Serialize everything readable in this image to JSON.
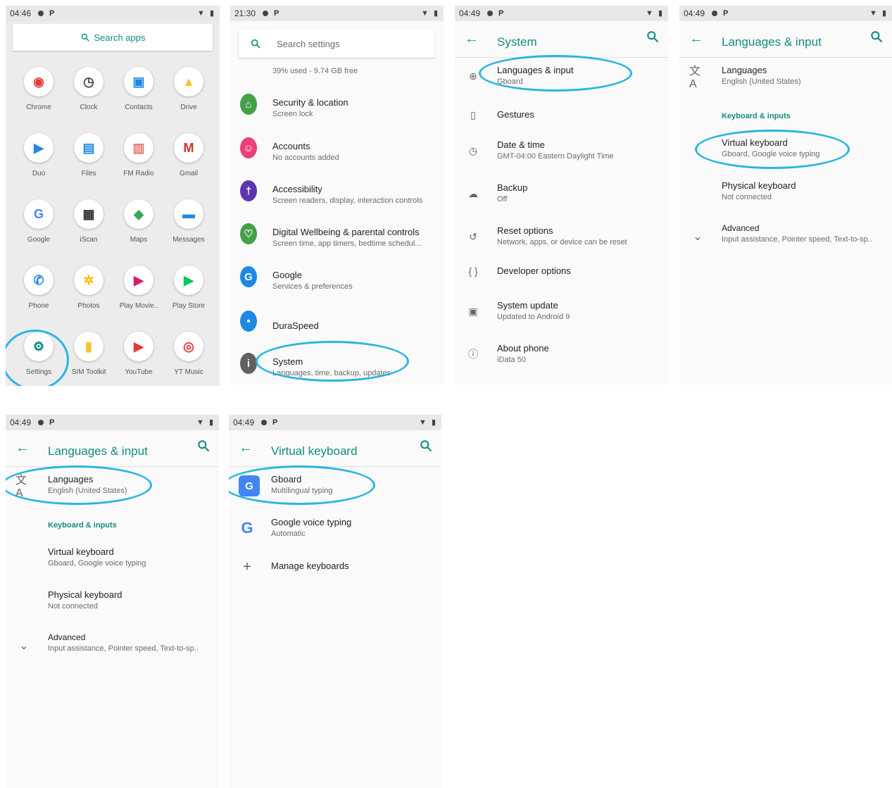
{
  "screen1": {
    "time": "04:46",
    "search_label": "Search apps",
    "apps": [
      {
        "label": "Chrome",
        "icon": "chrome-icon",
        "color": "#e53935"
      },
      {
        "label": "Clock",
        "icon": "clock-icon",
        "color": "#424242"
      },
      {
        "label": "Contacts",
        "icon": "contacts-icon",
        "color": "#1e88e5"
      },
      {
        "label": "Drive",
        "icon": "drive-icon",
        "color": "#fbc02d"
      },
      {
        "label": "Duo",
        "icon": "duo-icon",
        "color": "#1e88e5"
      },
      {
        "label": "Files",
        "icon": "files-icon",
        "color": "#1e88e5"
      },
      {
        "label": "FM Radio",
        "icon": "radio-icon",
        "color": "#e57373"
      },
      {
        "label": "Gmail",
        "icon": "gmail-icon",
        "color": "#d93025"
      },
      {
        "label": "Google",
        "icon": "google-icon",
        "color": "#4285f4"
      },
      {
        "label": "iScan",
        "icon": "barcode-icon",
        "color": "#333333"
      },
      {
        "label": "Maps",
        "icon": "maps-icon",
        "color": "#34a853"
      },
      {
        "label": "Messages",
        "icon": "messages-icon",
        "color": "#1e88e5"
      },
      {
        "label": "Phone",
        "icon": "phone-icon",
        "color": "#1e88e5"
      },
      {
        "label": "Photos",
        "icon": "photos-icon",
        "color": "#fbbc04"
      },
      {
        "label": "Play Movie..",
        "icon": "play-movies-icon",
        "color": "#d81b60"
      },
      {
        "label": "Play Store",
        "icon": "play-store-icon",
        "color": "#00c853"
      },
      {
        "label": "Settings",
        "icon": "settings-icon",
        "color": "#00897b"
      },
      {
        "label": "SIM Toolkit",
        "icon": "sim-toolkit-icon",
        "color": "#fbc02d"
      },
      {
        "label": "YouTube",
        "icon": "youtube-icon",
        "color": "#e53935"
      },
      {
        "label": "YT Music",
        "icon": "yt-music-icon",
        "color": "#e53935"
      }
    ]
  },
  "screen2": {
    "time": "21:30",
    "search_label": "Search settings",
    "storage_text": "39% used - 9.74 GB free",
    "items": [
      {
        "title": "Security & location",
        "subtitle": "Screen lock",
        "color": "#43a047",
        "glyph": "⌂"
      },
      {
        "title": "Accounts",
        "subtitle": "No accounts added",
        "color": "#ec407a",
        "glyph": "☺"
      },
      {
        "title": "Accessibility",
        "subtitle": "Screen readers, display, interaction controls",
        "color": "#5e35b1",
        "glyph": "†"
      },
      {
        "title": "Digital Wellbeing & parental controls",
        "subtitle": "Screen time, app timers, bedtime schedul...",
        "color": "#43a047",
        "glyph": "♡"
      },
      {
        "title": "Google",
        "subtitle": "Services & preferences",
        "color": "#1e88e5",
        "glyph": "G"
      },
      {
        "title": "DuraSpeed",
        "subtitle": "",
        "color": "#1e88e5",
        "glyph": "•"
      },
      {
        "title": "System",
        "subtitle": "Languages, time, backup, updates",
        "color": "#616161",
        "glyph": "i"
      }
    ]
  },
  "screen3": {
    "time": "04:49",
    "title": "System",
    "items": [
      {
        "title": "Languages & input",
        "subtitle": "Gboard",
        "glyph": "⊕"
      },
      {
        "title": "Gestures",
        "subtitle": "",
        "glyph": "▯"
      },
      {
        "title": "Date & time",
        "subtitle": "GMT-04:00 Eastern Daylight Time",
        "glyph": "◷"
      },
      {
        "title": "Backup",
        "subtitle": "Off",
        "glyph": "☁"
      },
      {
        "title": "Reset options",
        "subtitle": "Network, apps, or device can be reset",
        "glyph": "↺"
      },
      {
        "title": "Developer options",
        "subtitle": "",
        "glyph": "{ }"
      },
      {
        "title": "System update",
        "subtitle": "Updated to Android 9",
        "glyph": "▣"
      },
      {
        "title": "About phone",
        "subtitle": "iData 50",
        "glyph": "ⓘ"
      }
    ]
  },
  "screen4": {
    "time": "04:49",
    "title": "Languages & input",
    "languages_title": "Languages",
    "languages_subtitle": "English (United States)",
    "section": "Keyboard & inputs",
    "virtual_title": "Virtual keyboard",
    "virtual_subtitle": "Gboard, Google voice typing",
    "physical_title": "Physical keyboard",
    "physical_subtitle": "Not connected",
    "advanced_title": "Advanced",
    "advanced_subtitle": "Input assistance, Pointer speed, Text-to-sp.."
  },
  "screen5": {
    "time": "04:49",
    "title": "Languages & input",
    "languages_title": "Languages",
    "languages_subtitle": "English (United States)",
    "section": "Keyboard & inputs",
    "virtual_title": "Virtual keyboard",
    "virtual_subtitle": "Gboard, Google voice typing",
    "physical_title": "Physical keyboard",
    "physical_subtitle": "Not connected",
    "advanced_title": "Advanced",
    "advanced_subtitle": "Input assistance, Pointer speed, Text-to-sp.."
  },
  "screen6": {
    "time": "04:49",
    "title": "Virtual keyboard",
    "gboard_title": "Gboard",
    "gboard_subtitle": "Multilingual typing",
    "voice_title": "Google voice typing",
    "voice_subtitle": "Automatic",
    "manage_title": "Manage keyboards"
  },
  "colors": {
    "accent": "#138b80",
    "highlight": "#29b6e0"
  }
}
